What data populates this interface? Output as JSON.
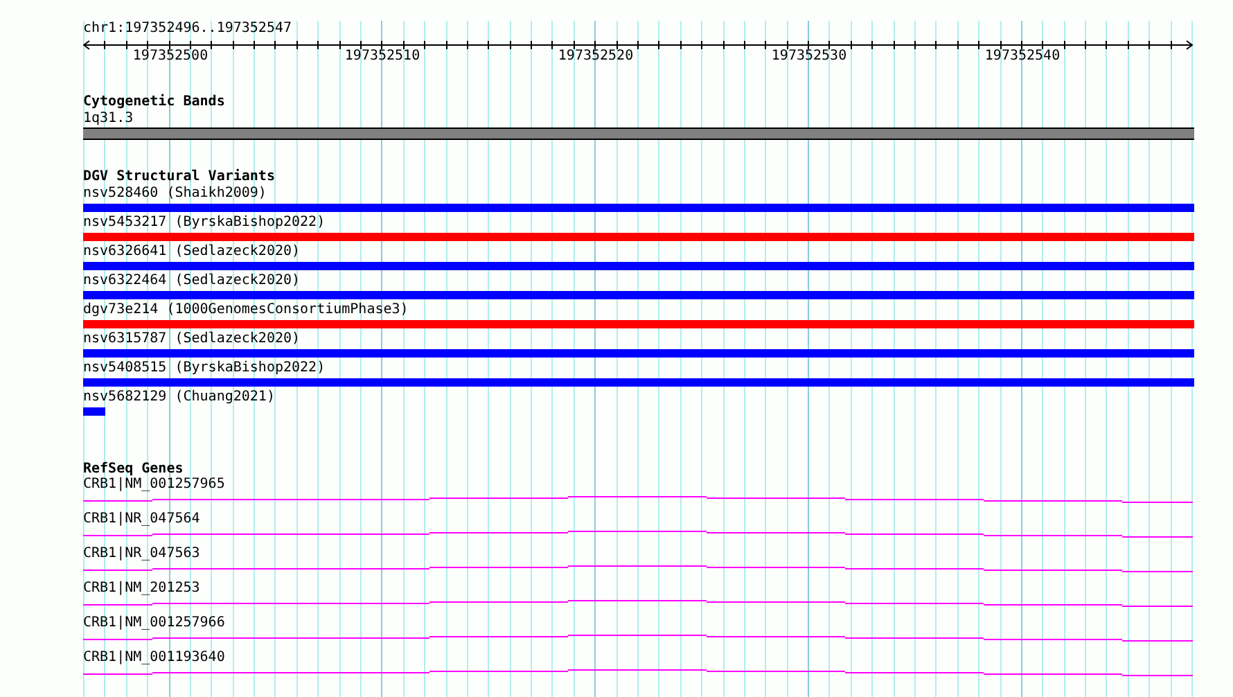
{
  "ruler": {
    "location": "chr1:197352496..197352547",
    "tick_labels": [
      "197352500",
      "197352510",
      "197352520",
      "197352530",
      "197352540"
    ]
  },
  "cytogenetic_bands": {
    "title": "Cytogenetic Bands",
    "features": [
      {
        "label": "1q31.3"
      }
    ]
  },
  "dgv_structural_variants": {
    "title": "DGV Structural Variants",
    "features": [
      {
        "label": "nsv528460 (Shaikh2009)",
        "color": "#0000ff",
        "kind": "full"
      },
      {
        "label": "nsv5453217 (ByrskaBishop2022)",
        "color": "#ff0000",
        "kind": "full"
      },
      {
        "label": "nsv6326641 (Sedlazeck2020)",
        "color": "#0000ff",
        "kind": "full"
      },
      {
        "label": "nsv6322464 (Sedlazeck2020)",
        "color": "#0000ff",
        "kind": "full"
      },
      {
        "label": "dgv73e214 (1000GenomesConsortiumPhase3)",
        "color": "#ff0000",
        "kind": "full"
      },
      {
        "label": "nsv6315787 (Sedlazeck2020)",
        "color": "#0000ff",
        "kind": "full"
      },
      {
        "label": "nsv5408515 (ByrskaBishop2022)",
        "color": "#0000ff",
        "kind": "full"
      },
      {
        "label": "nsv5682129 (Chuang2021)",
        "color": "#0000ff",
        "kind": "stub"
      }
    ]
  },
  "refseq_genes": {
    "title": "RefSeq Genes",
    "features": [
      {
        "label": "CRB1|NM_001257965"
      },
      {
        "label": "CRB1|NR_047564"
      },
      {
        "label": "CRB1|NR_047563"
      },
      {
        "label": "CRB1|NM_201253"
      },
      {
        "label": "CRB1|NM_001257966"
      },
      {
        "label": "CRB1|NM_001193640"
      }
    ]
  }
}
